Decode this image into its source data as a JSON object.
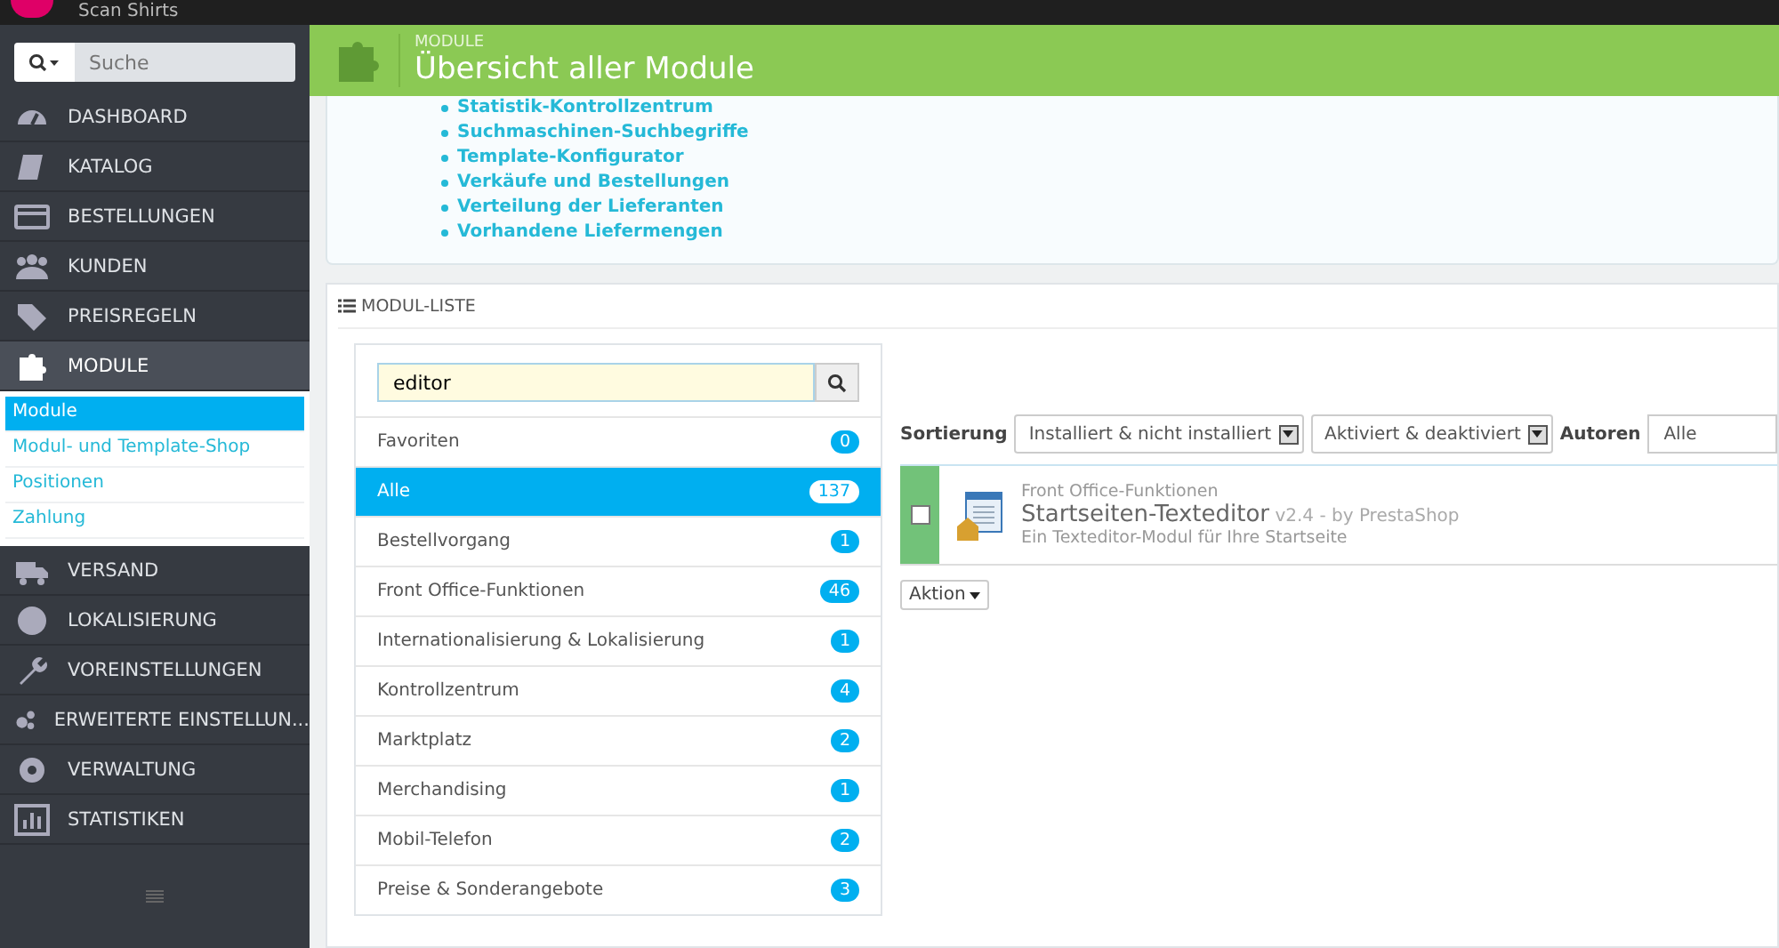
{
  "top_bar": {
    "shop_name": "Scan Shirts"
  },
  "sidebar": {
    "search": {
      "placeholder": "Suche"
    },
    "items": [
      {
        "label": "DASHBOARD",
        "selected": false
      },
      {
        "label": "KATALOG",
        "selected": false
      },
      {
        "label": "BESTELLUNGEN",
        "selected": false
      },
      {
        "label": "KUNDEN",
        "selected": false
      },
      {
        "label": "PREISREGELN",
        "selected": false
      },
      {
        "label": "MODULE",
        "selected": true,
        "children": [
          {
            "label": "Module",
            "selected": true
          },
          {
            "label": "Modul- und Template-Shop",
            "selected": false
          },
          {
            "label": "Positionen",
            "selected": false
          },
          {
            "label": "Zahlung",
            "selected": false
          }
        ]
      },
      {
        "label": "VERSAND",
        "selected": false
      },
      {
        "label": "LOKALISIERUNG",
        "selected": false
      },
      {
        "label": "VOREINSTELLUNGEN",
        "selected": false
      },
      {
        "label": "ERWEITERTE EINSTELLUN...",
        "selected": false
      },
      {
        "label": "VERWALTUNG",
        "selected": false
      },
      {
        "label": "STATISTIKEN",
        "selected": false
      }
    ]
  },
  "header": {
    "breadcrumb": "MODULE",
    "title": "Übersicht aller Module"
  },
  "link_list": [
    "Statistik-Kontrollzentrum",
    "Suchmaschinen-Suchbegriffe",
    "Template-Konfigurator",
    "Verkäufe und Bestellungen",
    "Verteilung der Lieferanten",
    "Vorhandene Liefermengen"
  ],
  "module_list": {
    "title": "MODUL-LISTE",
    "search": {
      "value": "editor"
    },
    "categories": [
      {
        "label": "Favoriten",
        "count": "0",
        "selected": false
      },
      {
        "label": "Alle",
        "count": "137",
        "selected": true
      },
      {
        "label": "Bestellvorgang",
        "count": "1",
        "selected": false
      },
      {
        "label": "Front Office-Funktionen",
        "count": "46",
        "selected": false
      },
      {
        "label": "Internationalisierung & Lokalisierung",
        "count": "1",
        "selected": false
      },
      {
        "label": "Kontrollzentrum",
        "count": "4",
        "selected": false
      },
      {
        "label": "Marktplatz",
        "count": "2",
        "selected": false
      },
      {
        "label": "Merchandising",
        "count": "1",
        "selected": false
      },
      {
        "label": "Mobil-Telefon",
        "count": "2",
        "selected": false
      },
      {
        "label": "Preise & Sonderangebote",
        "count": "3",
        "selected": false
      }
    ],
    "filters": {
      "sort_label": "Sortierung",
      "install_filter": "Installiert & nicht installiert",
      "active_filter": "Aktiviert & deaktiviert",
      "authors_label": "Autoren",
      "authors_value": "Alle"
    },
    "modules": [
      {
        "category": "Front Office-Funktionen",
        "name": "Startseiten-Texteditor",
        "version": "v2.4 - by PrestaShop",
        "description": "Ein Texteditor-Modul für Ihre Startseite",
        "checked": false,
        "installed": true
      }
    ],
    "bulk_action": "Aktion"
  }
}
